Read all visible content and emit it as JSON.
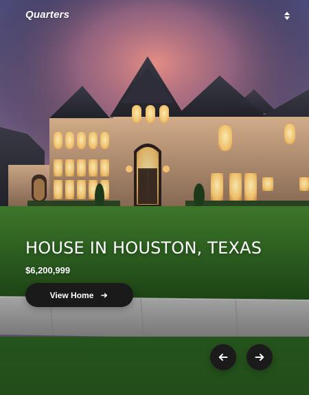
{
  "app": {
    "brand": "Quarters",
    "colors": {
      "text": "#ffffff",
      "button_bg": "#1a1a1a",
      "sky_top": "#4f4a75",
      "sky_glow": "#d07a78",
      "lawn": "#2f6a25"
    },
    "icons": {
      "sort": "up-down-caret-icon",
      "view_arrow": "arrow-right-icon",
      "prev": "arrow-left-icon",
      "next": "arrow-right-icon"
    }
  },
  "hero": {
    "title": "HOUSE IN HOUSTON, TEXAS",
    "price": "$6,200,999",
    "cta_label": "View Home"
  }
}
